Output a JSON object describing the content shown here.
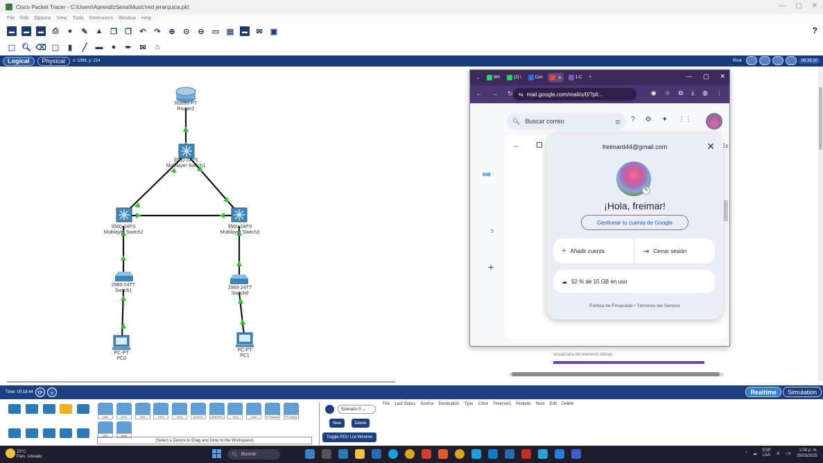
{
  "window": {
    "title": "Cisco Packet Tracer - C:\\Users\\AprendizSena\\Music\\red jerarquica.pkt"
  },
  "menu": [
    "File",
    "Edit",
    "Options",
    "View",
    "Tools",
    "Extensions",
    "Window",
    "Help"
  ],
  "toolbar": {
    "help": "?"
  },
  "workspace": {
    "logical_tab": "Logical",
    "physical_tab": "Physical",
    "coords": "x: 1099, y: 214",
    "root_label": "Root",
    "clock": "09:35:30"
  },
  "devices": {
    "router": {
      "model": "Router-PT",
      "name": "Router2"
    },
    "mls1": {
      "model": "3560-24PS",
      "name": "Multilayer Switch1"
    },
    "mls2": {
      "model": "3560-24PS",
      "name": "Multilayer Switch2"
    },
    "mls3": {
      "model": "3560-24PS",
      "name": "Multilayer Switch3"
    },
    "sw1": {
      "model": "2960-24TT",
      "name": "Switch1"
    },
    "sw0": {
      "model": "2960-24TT",
      "name": "Switch0"
    },
    "pc0": {
      "model": "PC-PT",
      "name": "PC0"
    },
    "pc1": {
      "model": "PC-PT",
      "name": "PC1"
    }
  },
  "timebar": {
    "time": "Time: 00:18:44",
    "realtime": "Realtime",
    "simulation": "Simulation"
  },
  "bottom": {
    "models": [
      "4331",
      "4321",
      "1941",
      "2901",
      "2911",
      "819IOX",
      "819HGW",
      "829",
      "1240",
      "PT-Router",
      "PT-Empty",
      "1841",
      "2620"
    ],
    "select_hint": "(Select a Device to Drag and Drop to the Workspace)",
    "scenario": "Scenario 0",
    "new": "New",
    "delete": "Delete",
    "toggle": "Toggle PDU List Window",
    "pdu_cols": [
      "Fire",
      "Last Status",
      "Source",
      "Destination",
      "Type",
      "Color",
      "Time(sec)",
      "Periodic",
      "Num",
      "Edit",
      "Delete"
    ]
  },
  "chrome": {
    "tabs": [
      "Wh",
      "(2) \\",
      "Con",
      "",
      "1-C"
    ],
    "url": "mail.google.com/mail/u/0/?pli...",
    "gmail_search": "Buscar correo",
    "inbox_count": "848",
    "count2": "5",
    "es": "Es",
    "bottom_text": "visualizarla del elemento debajo."
  },
  "account": {
    "email": "freimard44@gmail.com",
    "greeting": "¡Hola, freimar!",
    "manage": "Gestionar tu cuenta de Google",
    "add": "Añadir cuenta",
    "logout": "Cerrar sesión",
    "storage": "52 % de 15 GB en uso",
    "legal": "Política de Privacidad  •  Términos del Servicio"
  },
  "taskbar": {
    "temp": "23°C",
    "weather": "Parc. soleado",
    "search": "Buscar",
    "lang": "ESP",
    "lang2": "LAA",
    "time": "1:08 p. m.",
    "date": "25/03/2025"
  }
}
